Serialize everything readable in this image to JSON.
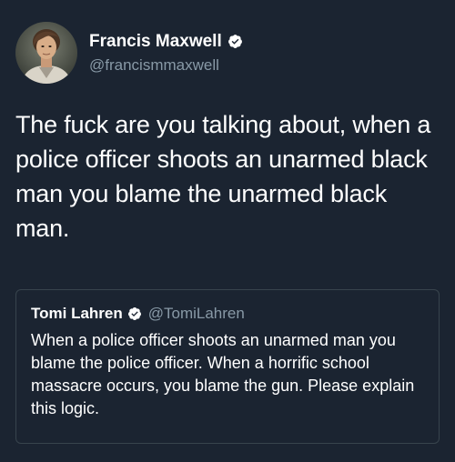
{
  "tweet": {
    "author": {
      "name": "Francis Maxwell",
      "handle": "@francismmaxwell",
      "verified": true
    },
    "text": "The fuck are you talking about, when a police officer shoots an unarmed black man you blame the unarmed black man.",
    "quoted_tweet": {
      "author": {
        "name": "Tomi Lahren",
        "handle": "@TomiLahren",
        "verified": true
      },
      "text": "When a police officer shoots an unarmed man you blame the police officer. When a horrific school massacre occurs, you blame the gun. Please explain this logic."
    }
  },
  "colors": {
    "background": "#1b2431",
    "text_primary": "#ffffff",
    "text_secondary": "#8899a6",
    "border": "#38444d",
    "verified_badge": "#ffffff"
  },
  "icons": {
    "author_verified": "verified-badge-icon",
    "quoted_verified": "verified-badge-icon"
  }
}
